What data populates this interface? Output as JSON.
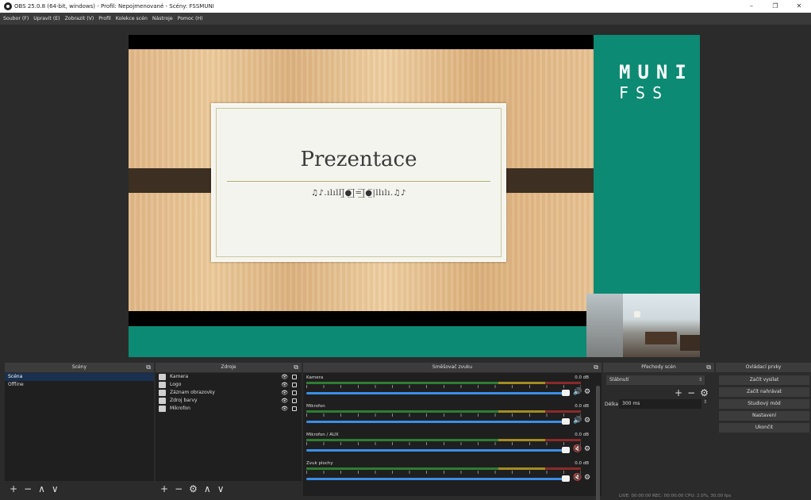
{
  "window": {
    "title": "OBS 25.0.8 (64-bit, windows) - Profil: Nepojmenované - Scény: FSSMUNI",
    "min": "–",
    "max": "❐",
    "close": "✕"
  },
  "menu": [
    "Soubor (F)",
    "Upravit (E)",
    "Zobrazit (V)",
    "Profil",
    "Kolekce scén",
    "Nástroje",
    "Pomoc (H)"
  ],
  "preview": {
    "slide_title": "Prezentace",
    "slide_subtitle": "♫♪.ılıll|̲̅●̲̅|̲̅=̲̅|̲̅●̲̅|llılı.♫♪",
    "logo_line1": "MUNI",
    "logo_line2": "FSS"
  },
  "panels": {
    "scenes": {
      "title": "Scény",
      "items": [
        "Scéna",
        "Offline"
      ],
      "selected": "Scéna"
    },
    "sources": {
      "title": "Zdroje",
      "items": [
        "Kamera",
        "Logo",
        "Záznam obrazovky",
        "Zdroj barvy",
        "Mikrofon"
      ]
    },
    "mixer": {
      "title": "Směšovač zvuku",
      "channels": [
        {
          "name": "Kamera",
          "db": "0.0 dB",
          "muted": false
        },
        {
          "name": "Mikrofon",
          "db": "0.0 dB",
          "muted": false
        },
        {
          "name": "Mikrofon / AUX",
          "db": "0.0 dB",
          "muted": true
        },
        {
          "name": "Zvuk plochy",
          "db": "0.0 dB",
          "muted": true
        }
      ]
    },
    "transitions": {
      "title": "Přechody scén",
      "selected": "Slábnutí",
      "duration_label": "Délka",
      "duration": "300 ms"
    },
    "controls": {
      "title": "Ovládací prvky",
      "buttons": [
        "Začít vysílat",
        "Začít nahrávat",
        "Studiový mód",
        "Nastavení",
        "Ukončit"
      ]
    }
  },
  "footer_glyphs": {
    "add": "+",
    "remove": "−",
    "up": "∧",
    "down": "∨",
    "gear": "⚙"
  },
  "status": "LIVE: 00:00:00   REC: 00:00:00   CPU: 2.0%, 30.00 fps",
  "colors": {
    "teal": "#0c8a73",
    "selection": "#19304f",
    "slider": "#3a8ee6",
    "muted": "#d43c3c"
  }
}
